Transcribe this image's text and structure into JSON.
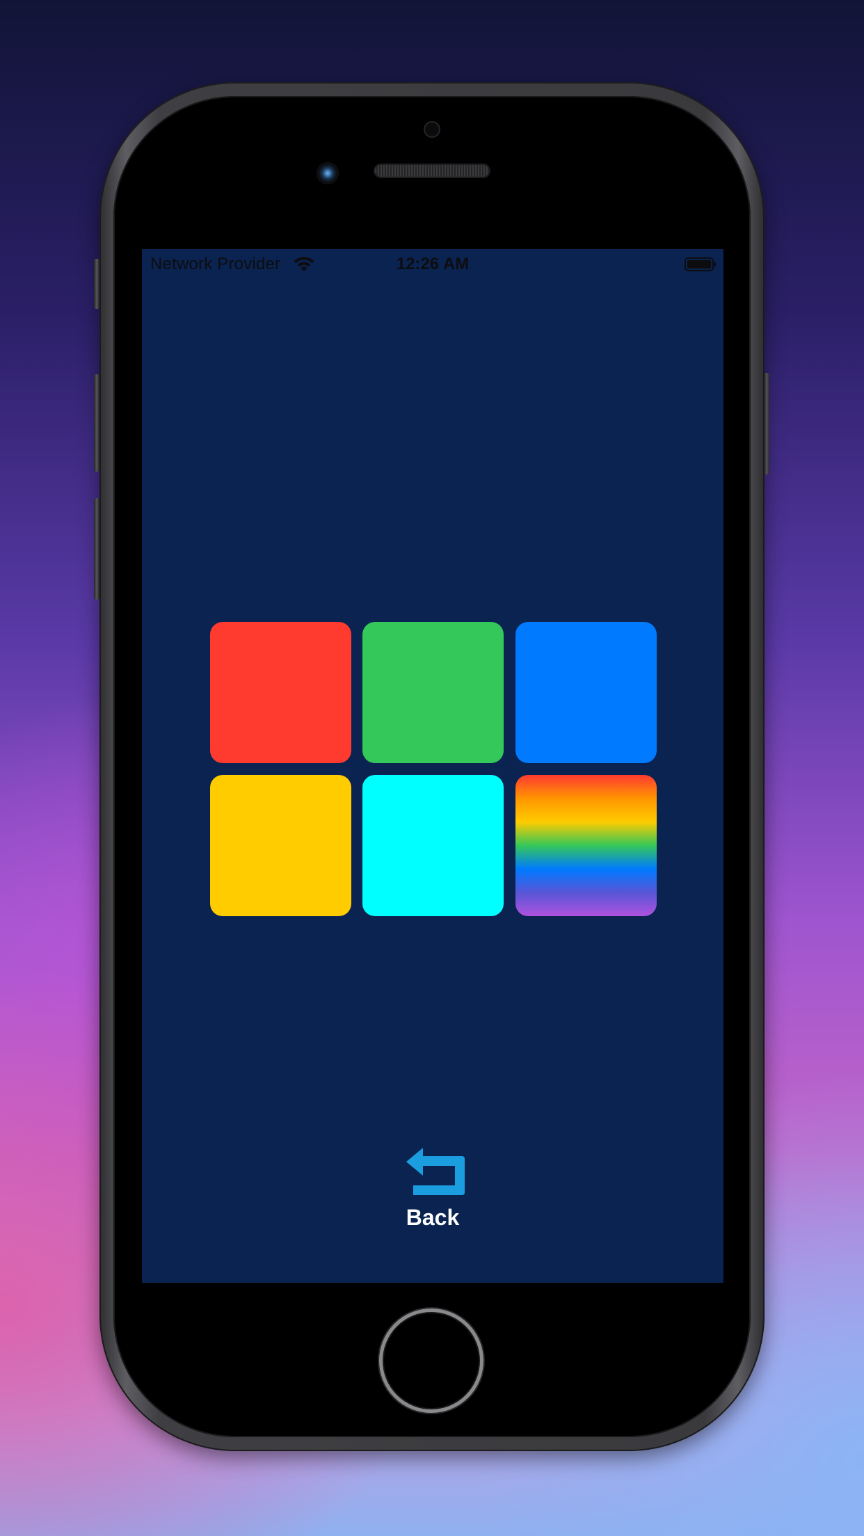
{
  "status_bar": {
    "carrier": "Network Provider",
    "time": "12:26 AM"
  },
  "screen": {
    "background": "#0a2350"
  },
  "tiles": [
    {
      "name": "tile-red",
      "color": "#ff3b30"
    },
    {
      "name": "tile-green",
      "color": "#34c759"
    },
    {
      "name": "tile-blue",
      "color": "#007aff"
    },
    {
      "name": "tile-yellow",
      "color": "#ffcc00"
    },
    {
      "name": "tile-cyan",
      "color": "#00ffff"
    },
    {
      "name": "tile-rainbow",
      "colors": [
        "#ff3b30",
        "#ff9500",
        "#ffcc00",
        "#34c759",
        "#007aff",
        "#5856d6",
        "#af52de"
      ]
    }
  ],
  "back_button": {
    "label": "Back",
    "icon": "return-arrow-icon",
    "icon_color": "#1a9ee0"
  },
  "icons": {
    "wifi": "wifi-icon",
    "battery": "battery-icon"
  }
}
